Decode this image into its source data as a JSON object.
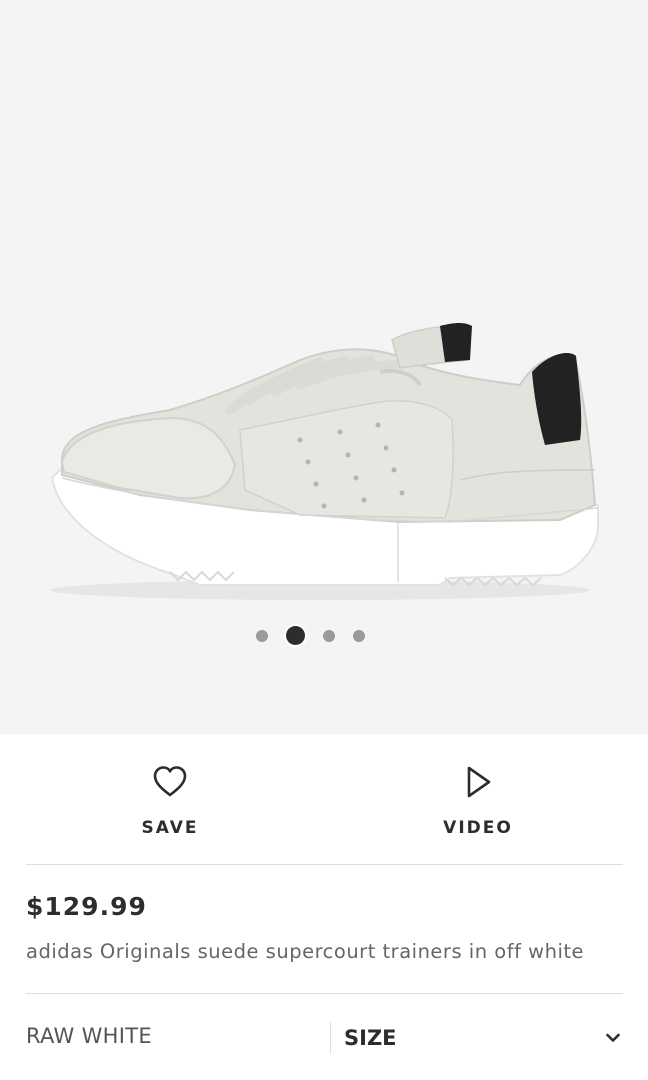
{
  "gallery": {
    "image_alt": "adidas Originals suede supercourt trainers in off white",
    "dots_count": 4,
    "active_index": 1
  },
  "actions": {
    "save_label": "SAVE",
    "video_label": "VIDEO"
  },
  "product": {
    "price": "$129.99",
    "title": "adidas Originals suede supercourt trainers in off white"
  },
  "options": {
    "colour": "RAW WHITE",
    "size_label": "SIZE"
  },
  "icons": {
    "save": "heart-icon",
    "video": "play-icon",
    "size_dropdown": "chevron-down-icon"
  },
  "colors": {
    "text_primary": "#2d2d2d",
    "text_secondary": "#666666",
    "image_background": "#f4f4f4",
    "dot_inactive": "#9a9a9a",
    "dot_active": "#2d2d2d",
    "divider": "#dddddd"
  }
}
